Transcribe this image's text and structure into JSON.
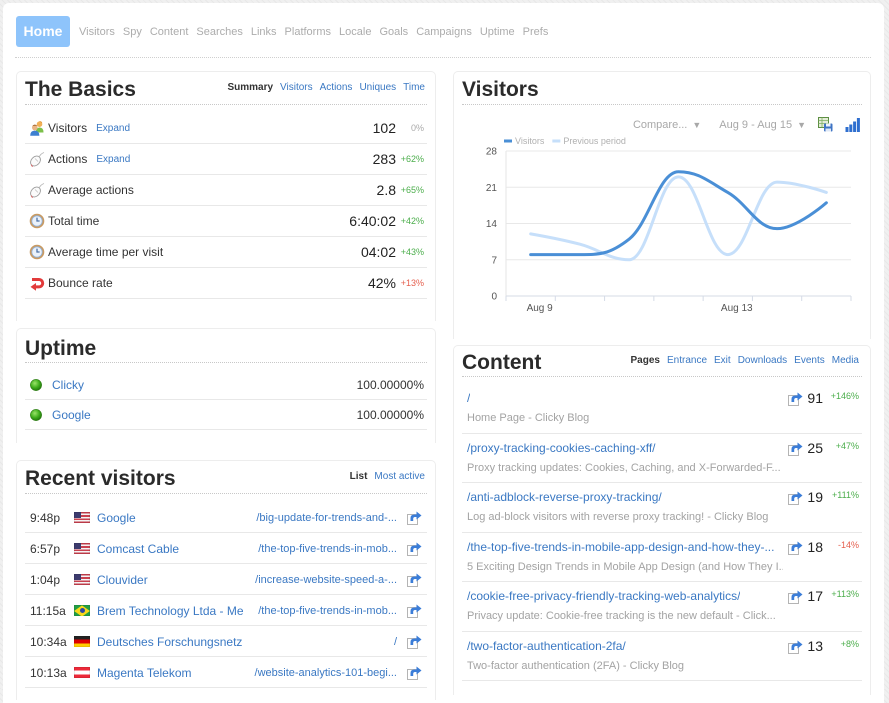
{
  "colors": {
    "link": "#3a78c3",
    "good": "#4cae4c",
    "bad": "#e5604f",
    "neutral": "#aaaaaa",
    "home": "#8ec4fb"
  },
  "nav": {
    "home": "Home",
    "items": [
      "Visitors",
      "Spy",
      "Content",
      "Searches",
      "Links",
      "Platforms",
      "Locale",
      "Goals",
      "Campaigns",
      "Uptime",
      "Prefs"
    ]
  },
  "basics": {
    "title": "The Basics",
    "tabs": [
      {
        "label": "Summary",
        "active": true
      },
      {
        "label": "Visitors",
        "active": false
      },
      {
        "label": "Actions",
        "active": false
      },
      {
        "label": "Uniques",
        "active": false
      },
      {
        "label": "Time",
        "active": false
      }
    ],
    "rows": [
      {
        "icon": "visitors-icon",
        "label": "Visitors",
        "expand": "Expand",
        "value": "102",
        "change": "0%",
        "trend": "neutral"
      },
      {
        "icon": "mouse-icon",
        "label": "Actions",
        "expand": "Expand",
        "value": "283",
        "change": "+62%",
        "trend": "good"
      },
      {
        "icon": "mouse-icon",
        "label": "Average actions",
        "value": "2.8",
        "change": "+65%",
        "trend": "good"
      },
      {
        "icon": "clock-icon",
        "label": "Total time",
        "value": "6:40:02",
        "change": "+42%",
        "trend": "good"
      },
      {
        "icon": "clock-icon",
        "label": "Average time per visit",
        "value": "04:02",
        "change": "+43%",
        "trend": "good"
      },
      {
        "icon": "bounce-icon",
        "label": "Bounce rate",
        "value": "42%",
        "change": "+13%",
        "trend": "bad"
      }
    ]
  },
  "uptime": {
    "title": "Uptime",
    "rows": [
      {
        "name": "Clicky",
        "value": "100.00000%",
        "status": "up"
      },
      {
        "name": "Google",
        "value": "100.00000%",
        "status": "up"
      }
    ]
  },
  "recent": {
    "title": "Recent visitors",
    "tabs": [
      {
        "label": "List",
        "active": true
      },
      {
        "label": "Most active",
        "active": false
      }
    ],
    "rows": [
      {
        "time": "9:48p",
        "country": "us",
        "name": "Google",
        "page": "/big-update-for-trends-and-..."
      },
      {
        "time": "6:57p",
        "country": "us",
        "name": "Comcast Cable",
        "page": "/the-top-five-trends-in-mob..."
      },
      {
        "time": "1:04p",
        "country": "us",
        "name": "Clouvider",
        "page": "/increase-website-speed-a-..."
      },
      {
        "time": "11:15a",
        "country": "br",
        "name": "Brem Technology Ltda - Me",
        "page": "/the-top-five-trends-in-mob..."
      },
      {
        "time": "10:34a",
        "country": "de",
        "name": "Deutsches Forschungsnetz",
        "page": "/"
      },
      {
        "time": "10:13a",
        "country": "at",
        "name": "Magenta Telekom",
        "page": "/website-analytics-101-begi..."
      }
    ]
  },
  "visitors_panel": {
    "title": "Visitors",
    "compare": "Compare...",
    "date_range": "Aug 9 - Aug 15",
    "caret": "▼"
  },
  "chart_data": {
    "type": "line",
    "title": "Visitors",
    "xlabel": "",
    "ylabel": "",
    "categories": [
      "Aug 9",
      "Aug 10",
      "Aug 11",
      "Aug 12",
      "Aug 13",
      "Aug 14",
      "Aug 15"
    ],
    "tick_label_indices": [
      0,
      4
    ],
    "ylim": [
      0,
      28
    ],
    "yticks": [
      0,
      7,
      14,
      21,
      28
    ],
    "grid": true,
    "legend": "top-left",
    "series": [
      {
        "name": "Visitors",
        "color": "#4a8fd6",
        "values": [
          8,
          8,
          11,
          24,
          20,
          13,
          18
        ]
      },
      {
        "name": "Previous period",
        "color": "#c6dffa",
        "values": [
          12,
          10,
          7,
          23,
          8,
          22,
          20
        ]
      }
    ]
  },
  "content": {
    "title": "Content",
    "tabs": [
      {
        "label": "Pages",
        "active": true
      },
      {
        "label": "Entrance",
        "active": false
      },
      {
        "label": "Exit",
        "active": false
      },
      {
        "label": "Downloads",
        "active": false
      },
      {
        "label": "Events",
        "active": false
      },
      {
        "label": "Media",
        "active": false
      }
    ],
    "rows": [
      {
        "path": "/",
        "title": "Home Page - Clicky Blog",
        "count": "91",
        "change": "+146%",
        "trend": "good"
      },
      {
        "path": "/proxy-tracking-cookies-caching-xff/",
        "title": "Proxy tracking updates: Cookies, Caching, and X-Forwarded-F...",
        "count": "25",
        "change": "+47%",
        "trend": "good"
      },
      {
        "path": "/anti-adblock-reverse-proxy-tracking/",
        "title": "Log ad-block visitors with reverse proxy tracking! - Clicky Blog",
        "count": "19",
        "change": "+111%",
        "trend": "good"
      },
      {
        "path": "/the-top-five-trends-in-mobile-app-design-and-how-they-...",
        "title": "5 Exciting Design Trends in Mobile App Design (and How They I...",
        "count": "18",
        "change": "-14%",
        "trend": "bad"
      },
      {
        "path": "/cookie-free-privacy-friendly-tracking-web-analytics/",
        "title": "Privacy update: Cookie-free tracking is the new default - Click...",
        "count": "17",
        "change": "+113%",
        "trend": "good"
      },
      {
        "path": "/two-factor-authentication-2fa/",
        "title": "Two-factor authentication (2FA) - Clicky Blog",
        "count": "13",
        "change": "+8%",
        "trend": "good"
      }
    ]
  }
}
